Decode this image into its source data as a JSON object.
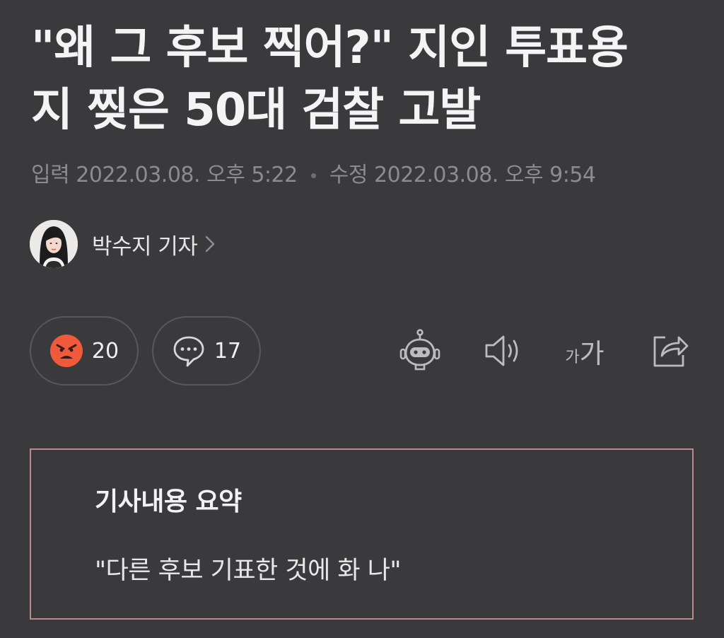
{
  "article": {
    "headline_line1": "\"왜 그 후보 찍어?\" 지인 투표용",
    "headline_line2": "지 찢은 50대 검찰 고발",
    "input_label": "입력",
    "input_time": "2022.03.08. 오후 5:22",
    "edit_label": "수정",
    "edit_time": "2022.03.08. 오후 9:54"
  },
  "author": {
    "name": "박수지 기자"
  },
  "reactions": {
    "angry_count": "20",
    "comment_count": "17"
  },
  "toolbar": {
    "font_size_label_small": "가",
    "font_size_label_large": "가"
  },
  "summary": {
    "title": "기사내용 요약",
    "text": "\"다른 후보 기표한 것에 화 나\""
  },
  "colors": {
    "background": "#3a3a3c",
    "angry_emoji": "#f05a3c",
    "summary_border": "#b98a8e"
  }
}
